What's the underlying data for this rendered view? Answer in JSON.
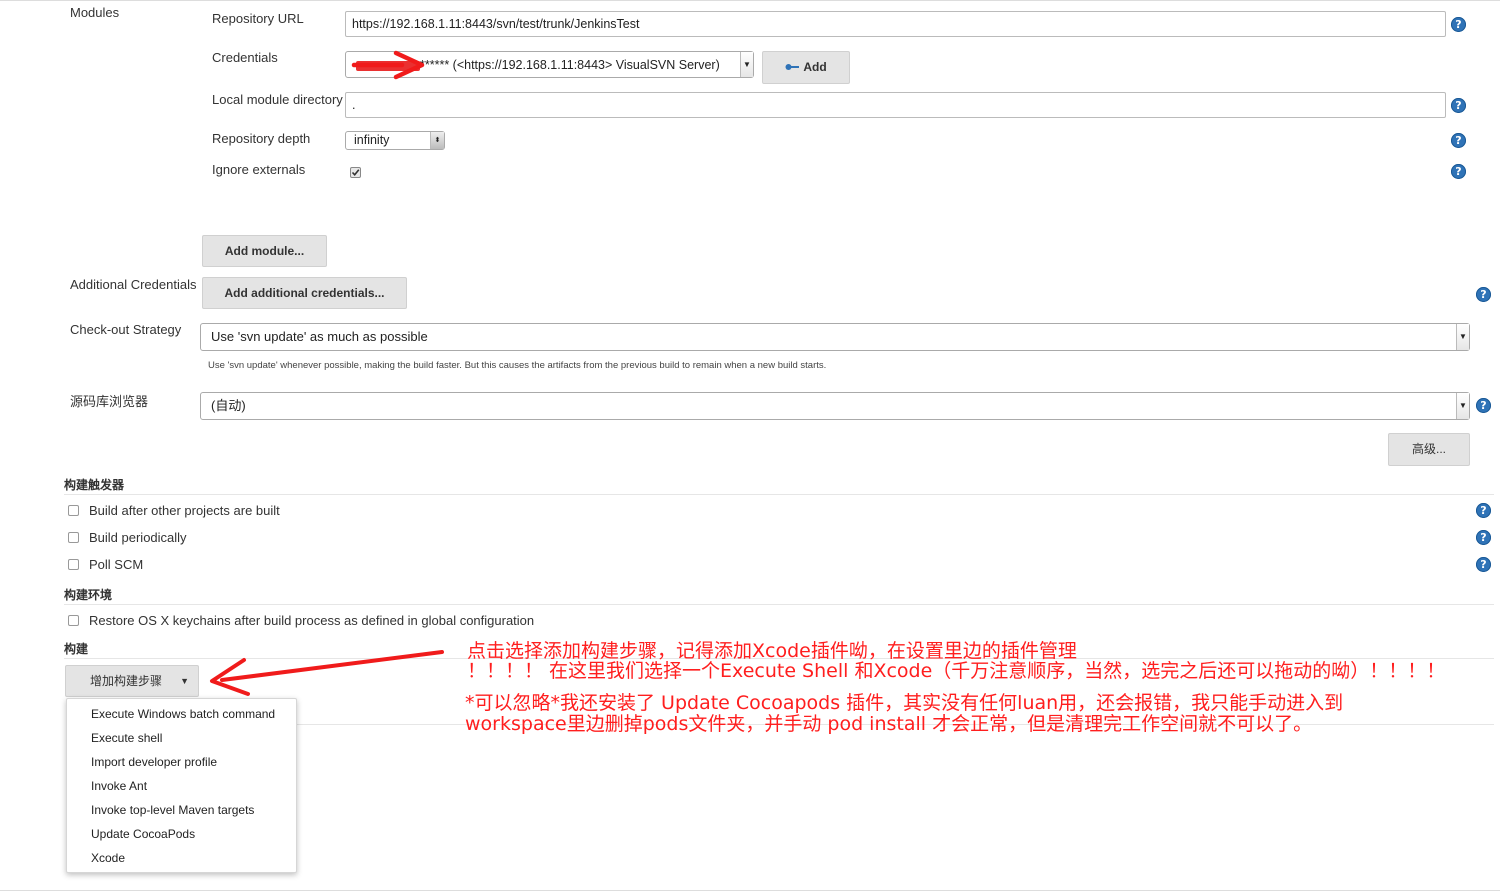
{
  "scm": {
    "modules_label": "Modules",
    "repository_url_label": "Repository URL",
    "repository_url_value": "https://192.168.1.11:8443/svn/test/trunk/JenkinsTest",
    "credentials_label": "Credentials",
    "credentials_value": "(<https://192.168.1.11:8443> VisualSVN Server)",
    "credentials_masked": "******",
    "credentials_add_label": "Add",
    "local_module_dir_label": "Local module directory",
    "local_module_dir_value": ".",
    "repository_depth_label": "Repository depth",
    "repository_depth_value": "infinity",
    "ignore_externals_label": "Ignore externals",
    "ignore_externals_checked": true,
    "add_module_label": "Add module...",
    "additional_credentials_label": "Additional Credentials",
    "add_additional_credentials_label": "Add additional credentials...",
    "checkout_strategy_label": "Check-out Strategy",
    "checkout_strategy_value": "Use 'svn update' as much as possible",
    "checkout_strategy_desc": "Use 'svn update' whenever possible, making the build faster. But this causes the artifacts from the previous build to remain when a new build starts.",
    "browser_label": "源码库浏览器",
    "browser_value": "(自动)",
    "advanced_label": "高级..."
  },
  "triggers": {
    "title": "构建触发器",
    "items": [
      {
        "label": "Build after other projects are built",
        "checked": false
      },
      {
        "label": "Build periodically",
        "checked": false
      },
      {
        "label": "Poll SCM",
        "checked": false
      }
    ]
  },
  "environment": {
    "title": "构建环境",
    "items": [
      {
        "label": "Restore OS X keychains after build process as defined in global configuration",
        "checked": false
      }
    ]
  },
  "build": {
    "title": "构建",
    "add_step_label": "增加构建步骤",
    "menu_items": [
      "Execute Windows batch command",
      "Execute shell",
      "Import developer profile",
      "Invoke Ant",
      "Invoke top-level Maven targets",
      "Update CocoaPods",
      "Xcode"
    ]
  },
  "annotations": {
    "line1": "点击选择添加构建步骤，记得添加Xcode插件呦，在设置里边的插件管理",
    "line2": "！！！！ 在这里我们选择一个Execute Shell 和Xcode（千万注意顺序，当然，选完之后还可以拖动的呦）！！！！",
    "line3": "*可以忽略*我还安装了 Update Cocoapods 插件，其实没有任何luan用，还会报错，我只能手动进入到",
    "line4": "workspace里边删掉pods文件夹，并手动 pod install 才会正常，但是清理完工作空间就不可以了。"
  },
  "colors": {
    "annotation": "#ff1e1e",
    "help_icon": "#2f73b7",
    "button_bg": "#e4e4e4"
  }
}
